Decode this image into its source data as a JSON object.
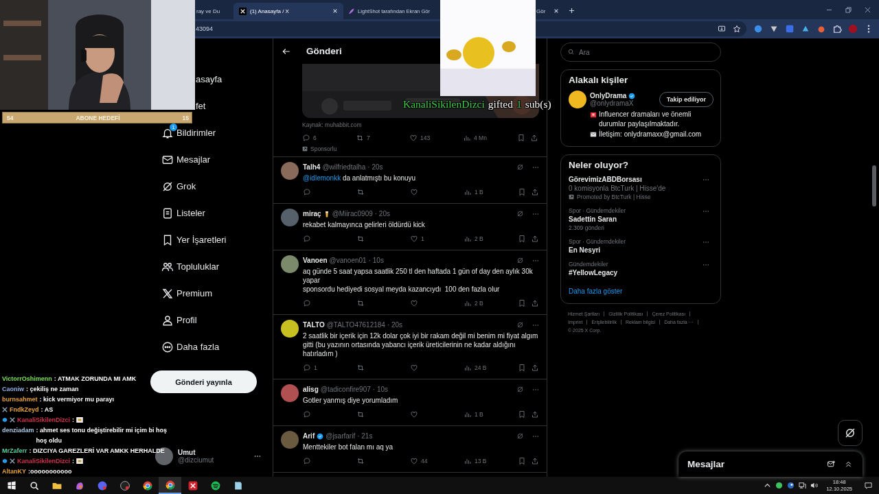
{
  "browser": {
    "tabs": [
      {
        "title": "ray ve Du",
        "kind": "plain",
        "selected": false
      },
      {
        "title": "(1) Anasayfa / X",
        "kind": "x",
        "closable": true,
        "selected": true
      },
      {
        "title": "LightShot tarafından Ekran Gör",
        "kind": "feather",
        "selected": false
      },
      {
        "title": "Gör",
        "kind": "hidden",
        "closable": true,
        "selected": false
      }
    ],
    "address": "43094"
  },
  "stream": {
    "goal": {
      "start": "54",
      "label": "ABONE HEDEFİ",
      "end": "15"
    },
    "alert": {
      "user": "KanaliSikilenDizci",
      "verb": "gifted",
      "count": "1",
      "unit": "sub(s)"
    },
    "chat": [
      {
        "user": "VictorrOshimenn",
        "color": "#7ee05a",
        "message": ": ATMAK ZORUNDA MI AMK"
      },
      {
        "user": "Caoniw",
        "color": "#8fb0e8",
        "message": ": çekiliş ne zaman"
      },
      {
        "user": "burnsahmet",
        "color": "#e8a23a",
        "message": ": kick vermiyor mu parayı"
      },
      {
        "user": "FndkZeyd",
        "color": "#e8a23a",
        "sword": true,
        "message": ": AS"
      },
      {
        "user": "KanaliSikilenDizci",
        "color": "#d0304a",
        "gem": true,
        "sword": true,
        "message": ":",
        "emote": true
      },
      {
        "user": "denziadam",
        "color": "#a8c8e8",
        "message": ": ahmet ses tonu değiştirebilir mi içim bi hoş hoş oldu"
      },
      {
        "user": "MrZaferr",
        "color": "#5ad0a0",
        "message": ": DIZCIYA GAREZLERİ VAR AMKK HERHALDE"
      },
      {
        "user": "KanaliSikilenDizci",
        "color": "#d0304a",
        "gem": true,
        "sword": true,
        "message": ":",
        "emote": true
      },
      {
        "user": "AltanKY",
        "color": "#e8a23a",
        "message": ":ooooooooooo"
      }
    ]
  },
  "x": {
    "nav": {
      "items": [
        {
          "label": "asayfa",
          "kind": "cut"
        },
        {
          "label": "fet",
          "kind": "cut"
        },
        {
          "label": "Bildirimler",
          "kind": "bell",
          "badge": "1"
        },
        {
          "label": "Mesajlar",
          "kind": "mail"
        },
        {
          "label": "Grok",
          "kind": "grok"
        },
        {
          "label": "Listeler",
          "kind": "list"
        },
        {
          "label": "Yer İşaretleri",
          "kind": "bookmark"
        },
        {
          "label": "Topluluklar",
          "kind": "people"
        },
        {
          "label": "Premium",
          "kind": "xlogo"
        },
        {
          "label": "Profil",
          "kind": "person"
        },
        {
          "label": "Daha fazla",
          "kind": "more"
        }
      ],
      "post_button": "Gönderi yayınla",
      "account": {
        "name": "Umut",
        "handle": "@dizciumut"
      }
    },
    "header": "Gönderi",
    "ad": {
      "kind": "picture",
      "source": "Kaynak: muhabbit.com",
      "stats": {
        "replies": "6",
        "reposts": "7",
        "likes": "143",
        "views": "4 Mn"
      },
      "label": "Sponsorlu"
    },
    "replies": [
      {
        "name": "Talh4",
        "handle": "@wilfriedtalha",
        "time": "· 20s",
        "mention": "@idlemonkk",
        "text": "da anlatmıştı bu konuyu",
        "stats": {
          "views": "1 B"
        }
      },
      {
        "name": "miraç",
        "cup": true,
        "handle": "@Miirac0909",
        "time": "· 20s",
        "text": "rekabet kalmayınca gelirleri öldürdü kick",
        "stats": {
          "likes": "1",
          "views": "2 B"
        }
      },
      {
        "name": "Vanoen",
        "handle": "@vanoen01",
        "time": "· 10s",
        "text": "aq günde 5 saat yapsa saatlik 250 tl den haftada 1 gün of day den aylık 30k yapar\nsponsordu hediyedi sosyal meyda kazancıydı  100 den fazla olur",
        "stats": {
          "views": "2 B"
        }
      },
      {
        "name": "TALTO",
        "handle": "@TALTO47612184",
        "time": "· 20s",
        "text": "2 saatlik bir içerik için 12k dolar çok iyi bir rakam değil mi benim mi fiyat algım gitti (bu yazının ortasında yabancı içerik üreticilerinin ne kadar aldığını hatırladım )",
        "stats": {
          "replies": "1",
          "views": "24 B"
        }
      },
      {
        "name": "alisg",
        "handle": "@tadiconfire907",
        "time": "· 10s",
        "text": "Gotler yanmış diye yorumladım",
        "stats": {
          "views": "1 B"
        }
      },
      {
        "name": "Arif",
        "verified": true,
        "handle": "@jsarfarif",
        "time": "· 21s",
        "text": "Menttekiler bot falan mı aq ya",
        "stats": {
          "likes": "44",
          "views": "13 B"
        }
      }
    ],
    "search": {
      "placeholder": "Ara"
    },
    "related": {
      "title": "Alakalı kişiler",
      "people": [
        {
          "name": "OnlyDrama",
          "verified": true,
          "handle": "@onlydramaX",
          "button": "Takip ediliyor",
          "bio": "Influencer dramaları ve önemli durumlar paylaşılmaktadır.",
          "contact": "İletişim: onlydramaxx@gmail.com"
        }
      ]
    },
    "trends": {
      "title": "Neler oluyor?",
      "items": [
        {
          "kind": "promoted",
          "title": "GörevimizABDBorsası",
          "subtitle": "0 komisyonla BtcTurk | Hisse'de",
          "promoted": "Promoted by BtcTurk | Hisse"
        },
        {
          "kind": "trend",
          "context": "Spor · Gündemdekiler",
          "title": "Sadettin Saran",
          "count": "2.309 gönderi"
        },
        {
          "kind": "trend",
          "context": "Spor · Gündemdekiler",
          "title": "En Nesyri"
        },
        {
          "kind": "trend",
          "context": "Gündemdekiler",
          "title": "#YellowLegacy"
        }
      ],
      "more": "Daha fazla göster"
    },
    "footer": {
      "links": [
        "Hizmet Şartları",
        "Gizlilik Politikası",
        "Çerez Politikası",
        "Imprint",
        "Erişilebilirlik",
        "Reklam bilgisi",
        "Daha fazla ···"
      ],
      "copyright": "© 2025 X Corp."
    },
    "messages": {
      "title": "Mesajlar"
    }
  },
  "taskbar": {
    "apps": [
      {
        "kind": "windows",
        "selected": false
      },
      {
        "kind": "search",
        "selected": false
      },
      {
        "kind": "folder",
        "selected": false
      },
      {
        "kind": "copilot",
        "selected": false
      },
      {
        "kind": "discord",
        "selected": false
      },
      {
        "kind": "obs",
        "selected": false
      },
      {
        "kind": "chrome",
        "selected": false
      },
      {
        "kind": "chrome",
        "selected": true
      },
      {
        "kind": "xapp",
        "selected": false
      },
      {
        "kind": "spotify",
        "selected": false
      },
      {
        "kind": "notes",
        "selected": false
      }
    ],
    "time": "18:48",
    "date": "12.10.2025"
  }
}
